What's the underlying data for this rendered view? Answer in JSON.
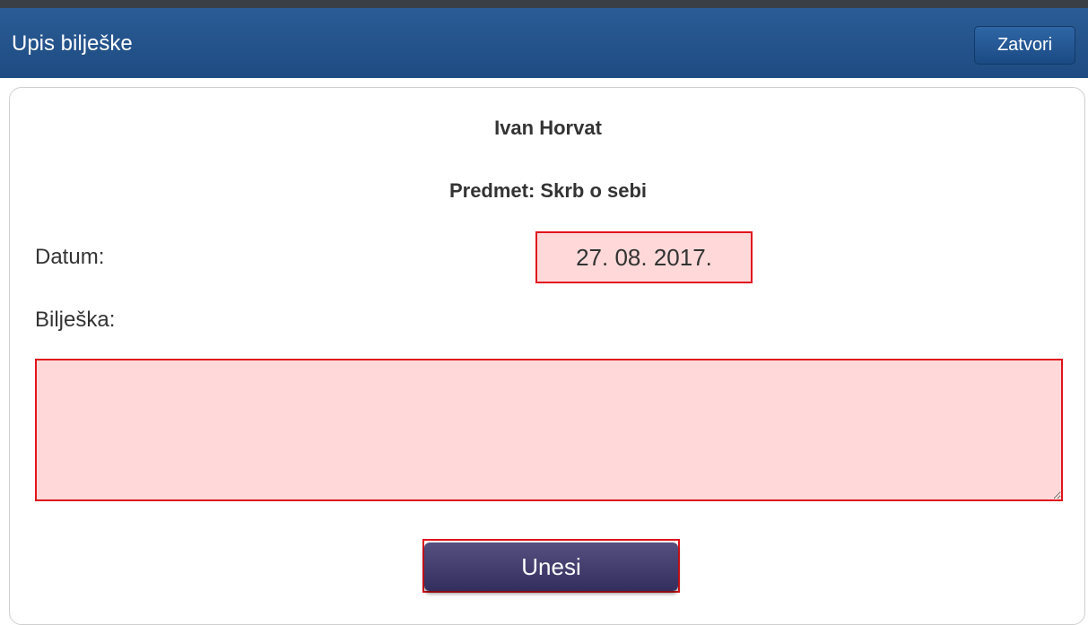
{
  "header": {
    "title": "Upis bilješke",
    "close_label": "Zatvori"
  },
  "student": {
    "name": "Ivan Horvat",
    "subject": "Predmet: Skrb o sebi"
  },
  "form": {
    "date_label": "Datum:",
    "date_value": "27. 08. 2017.",
    "note_label": "Bilješka:",
    "note_value": "",
    "submit_label": "Unesi"
  },
  "colors": {
    "header_bg": "#1e4b82",
    "error_border": "#e0141c",
    "error_bg": "#ffd9da",
    "submit_bg": "#3c3768"
  }
}
